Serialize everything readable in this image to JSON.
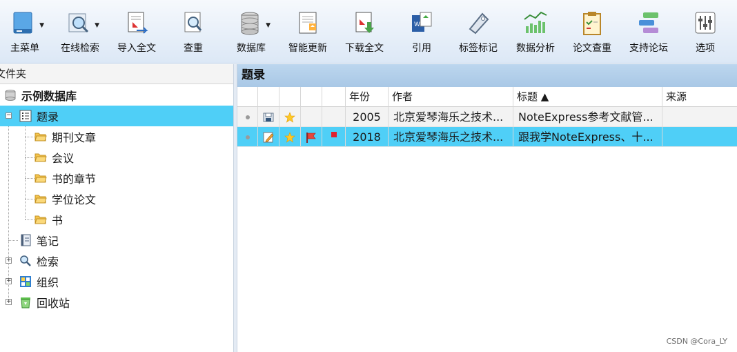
{
  "toolbar": {
    "buttons": [
      {
        "label": "主菜单",
        "icon": "main-menu-icon",
        "dropdown": true
      },
      {
        "label": "在线检索",
        "icon": "online-search-icon",
        "dropdown": true
      },
      {
        "label": "导入全文",
        "icon": "import-fulltext-icon",
        "dropdown": false
      },
      {
        "label": "查重",
        "icon": "find-duplicates-icon",
        "dropdown": false
      },
      {
        "label": "数据库",
        "icon": "database-icon",
        "dropdown": true
      },
      {
        "label": "智能更新",
        "icon": "smart-update-icon",
        "dropdown": false
      },
      {
        "label": "下载全文",
        "icon": "download-fulltext-icon",
        "dropdown": false
      },
      {
        "label": "引用",
        "icon": "cite-icon",
        "dropdown": false
      },
      {
        "label": "标签标记",
        "icon": "tag-icon",
        "dropdown": false
      },
      {
        "label": "数据分析",
        "icon": "data-analysis-icon",
        "dropdown": false
      },
      {
        "label": "论文查重",
        "icon": "paper-check-icon",
        "dropdown": false
      },
      {
        "label": "支持论坛",
        "icon": "forum-icon",
        "dropdown": false
      },
      {
        "label": "选项",
        "icon": "options-icon",
        "dropdown": false
      }
    ]
  },
  "left_panel": {
    "header": "文件夹",
    "tree": {
      "database": "示例数据库",
      "records": "题录",
      "records_children": [
        "期刊文章",
        "会议",
        "书的章节",
        "学位论文",
        "书"
      ],
      "notes": "笔记",
      "search": "检索",
      "organize": "组织",
      "recycle": "回收站"
    }
  },
  "right_panel": {
    "title": "题录",
    "columns": [
      "年份",
      "作者",
      "标题 ▲",
      "来源"
    ],
    "rows": [
      {
        "year": "2005",
        "author": "北京爱琴海乐之技术...",
        "title": "NoteExpress参考文献管...",
        "source": "",
        "icons": [
          "dot",
          "save",
          "star"
        ]
      },
      {
        "year": "2018",
        "author": "北京爱琴海乐之技术...",
        "title": "跟我学NoteExpress、十...",
        "source": "",
        "icons": [
          "dot",
          "note",
          "star",
          "flag",
          "red-square"
        ]
      }
    ]
  },
  "watermark": "CSDN @Cora_LY",
  "colors": {
    "selection": "#4fcff7",
    "header": "#b6d1ec"
  }
}
